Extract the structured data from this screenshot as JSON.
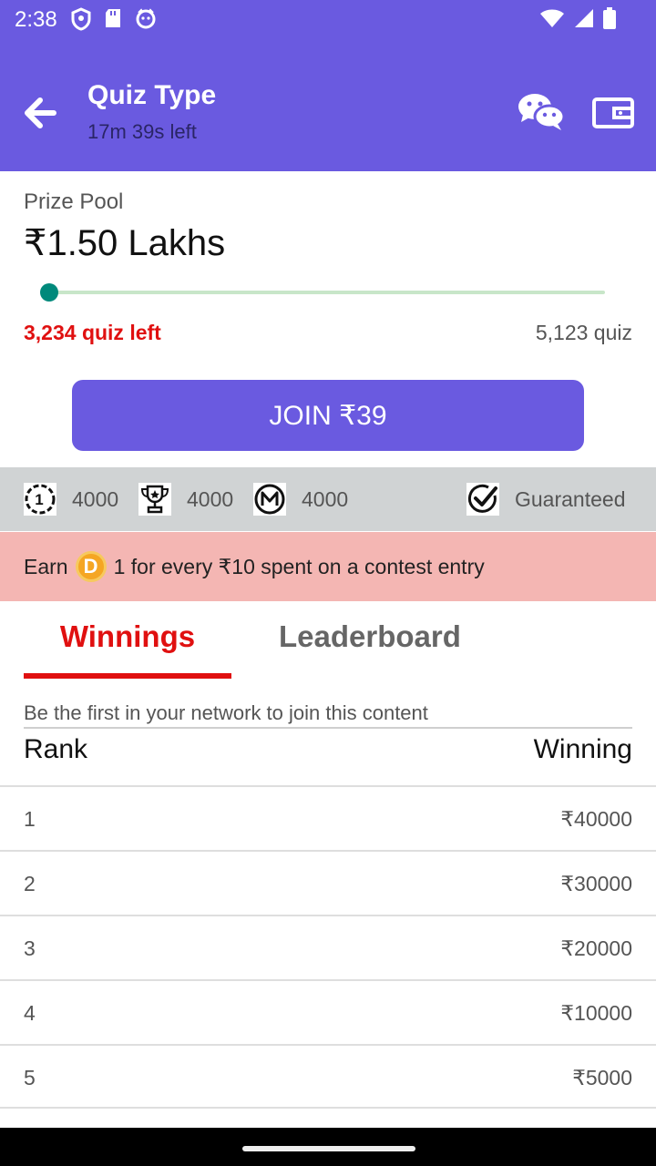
{
  "status_bar": {
    "time": "2:38",
    "icons_left": [
      "shield-icon",
      "sd-card-icon",
      "cat-face-icon"
    ],
    "icons_right": [
      "wifi-icon",
      "cellular-signal-icon",
      "battery-icon"
    ]
  },
  "app_bar": {
    "title": "Quiz Type",
    "subtitle": "17m 39s left",
    "back_icon": "arrow-left-icon",
    "chat_icon": "wechat-icon",
    "wallet_icon": "wallet-icon",
    "bg_color": "#6a5ae0"
  },
  "prize": {
    "label": "Prize Pool",
    "value": "₹1.50 Lakhs",
    "progress_fraction": 0.01,
    "quiz_left": "3,234 quiz left",
    "quiz_total": "5,123 quiz"
  },
  "join_button": {
    "label": "JOIN ₹39"
  },
  "stats": [
    {
      "icon": "first-place-icon",
      "value": "4000"
    },
    {
      "icon": "trophy-icon",
      "value": "4000"
    },
    {
      "icon": "m-circle-icon",
      "value": "4000"
    }
  ],
  "guaranteed": {
    "icon": "check-circle-icon",
    "label": "Guaranteed"
  },
  "earn_banner": {
    "prefix": "Earn",
    "coin_letter": "D",
    "suffix": "1 for every ₹10 spent on a contest entry"
  },
  "tabs": [
    {
      "label": "Winnings",
      "active": true
    },
    {
      "label": "Leaderboard",
      "active": false
    }
  ],
  "network_note": "Be the first in your network to join this content",
  "table": {
    "headers": {
      "rank": "Rank",
      "winning": "Winning"
    },
    "rows": [
      {
        "rank": "1",
        "amount": "₹40000"
      },
      {
        "rank": "2",
        "amount": "₹30000"
      },
      {
        "rank": "3",
        "amount": "₹20000"
      },
      {
        "rank": "4",
        "amount": "₹10000"
      },
      {
        "rank": "5",
        "amount": "₹5000"
      }
    ]
  },
  "colors": {
    "accent": "#6a5ae0",
    "red": "#e01010",
    "progress": "#00897b",
    "banner": "#f4b6b3"
  }
}
